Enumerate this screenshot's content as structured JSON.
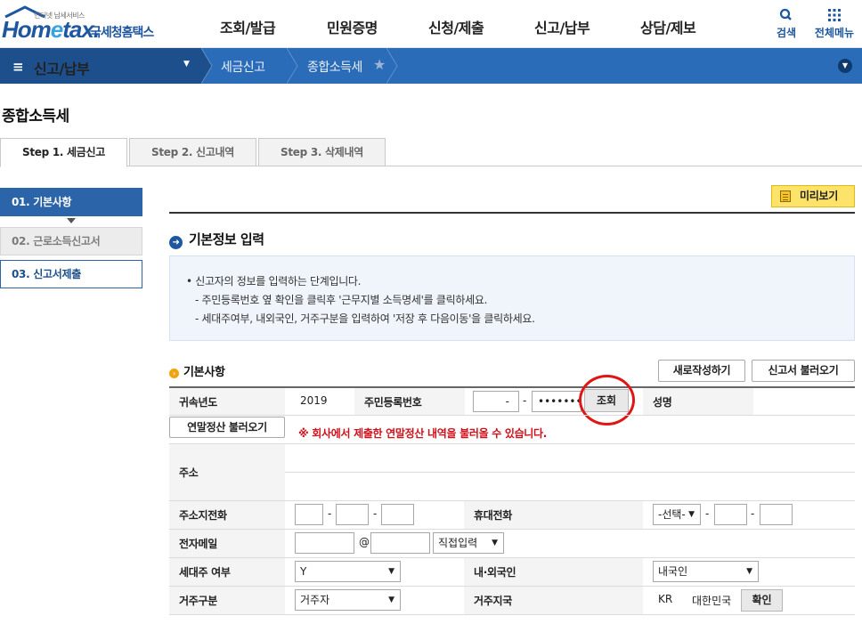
{
  "header": {
    "logo_tagline": "인터넷 납세서비스",
    "logo_brand_a": "Hom",
    "logo_brand_e": "e",
    "logo_brand_b": "tax.",
    "logo_name": "국세청홈택스",
    "nav": [
      "조회/발급",
      "민원증명",
      "신청/제출",
      "신고/납부",
      "상담/제보"
    ],
    "search_label": "검색",
    "menu_label": "전체메뉴"
  },
  "location": {
    "main": "신고/납부",
    "crumbs": [
      "세금신고",
      "종합소득세"
    ]
  },
  "page_title": "종합소득세",
  "tabs": [
    "Step 1. 세금신고",
    "Step 2. 신고내역",
    "Step 3. 삭제내역"
  ],
  "side_steps": [
    "01. 기본사항",
    "02. 근로소득신고서",
    "03. 신고서제출"
  ],
  "preview_label": "미리보기",
  "section_title": "기본정보 입력",
  "info_lines": [
    "• 신고자의 정보를 입력하는 단계입니다.",
    "- 주민등록번호 옆 확인을 클릭후 '근무지별 소득명세'를 클릭하세요.",
    "- 세대주여부, 내외국인, 거주구분을 입력하여 '저장 후 다음이동'을 클릭하세요."
  ],
  "basic": {
    "title": "기본사항",
    "new_label": "새로작성하기",
    "load_label": "신고서 불러오기"
  },
  "form": {
    "year_label": "귀속년도",
    "year_value": "2019",
    "rrn_label": "주민등록번호",
    "rrn_front": "-",
    "rrn_back": "•••••••",
    "lookup_label": "조회",
    "name_label": "성명",
    "yearend_label": "연말정산 불러오기",
    "notice": "※ 회사에서 제출한 연말정산 내역을 불러올 수 있습니다.",
    "address_label": "주소",
    "addr_phone_label": "주소지전화",
    "mobile_label": "휴대전화",
    "mobile_select": "-선택-",
    "email_label": "전자메일",
    "email_at": "@",
    "email_domain": "직접입력",
    "householder_label": "세대주 여부",
    "householder_value": "Y",
    "nationality_label": "내·외국인",
    "nationality_value": "내국인",
    "residence_label": "거주구분",
    "residence_value": "거주자",
    "country_label": "거주지국",
    "country_code": "KR",
    "country_name": "대한민국",
    "confirm_label": "확인"
  }
}
